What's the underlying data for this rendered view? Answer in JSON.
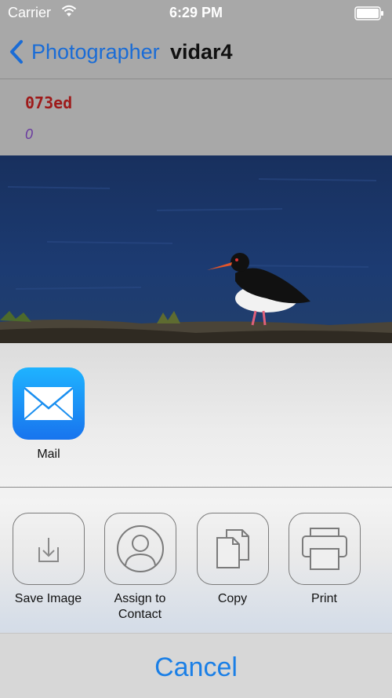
{
  "status_bar": {
    "carrier": "Carrier",
    "time": "6:29 PM",
    "wifi_icon": "wifi-icon",
    "battery_icon": "battery-icon"
  },
  "nav": {
    "back_label": "Photographer",
    "title": "vidar4",
    "back_icon": "chevron-left-icon"
  },
  "info": {
    "code": "073ed",
    "count": "0"
  },
  "photo": {
    "subject": "oystercatcher-bird"
  },
  "share": {
    "apps": [
      {
        "label": "Mail",
        "icon": "mail-icon"
      }
    ],
    "actions": [
      {
        "label": "Save Image",
        "icon": "save-image-icon"
      },
      {
        "label": "Assign to Contact",
        "icon": "contact-icon"
      },
      {
        "label": "Copy",
        "icon": "copy-icon"
      },
      {
        "label": "Print",
        "icon": "print-icon"
      }
    ],
    "cancel_label": "Cancel"
  },
  "colors": {
    "accent": "#1a6cd6",
    "code": "#9e1a1a",
    "count": "#6a3aa0"
  }
}
